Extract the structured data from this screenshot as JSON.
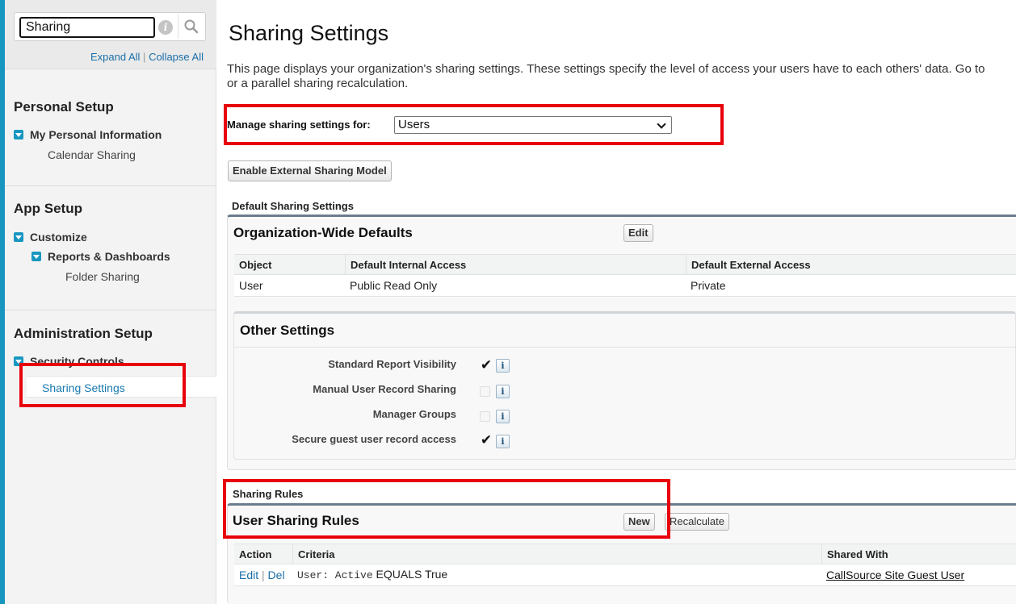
{
  "sidebar": {
    "search": {
      "value": "Sharing"
    },
    "expand_all": "Expand All",
    "separator": "|",
    "collapse_all": "Collapse All",
    "sections": [
      {
        "title": "Personal Setup",
        "node": "My Personal Information",
        "leaf": "Calendar Sharing"
      },
      {
        "title": "App Setup",
        "node": "Customize",
        "subnode": "Reports & Dashboards",
        "leaf": "Folder Sharing"
      },
      {
        "title": "Administration Setup",
        "node": "Security Controls",
        "leaf": "Sharing Settings"
      }
    ]
  },
  "main": {
    "title": "Sharing Settings",
    "description_line1": "This page displays your organization's sharing settings. These settings specify the level of access your users have to each others' data. Go to",
    "description_line2": "or a parallel sharing recalculation.",
    "manage_label": "Manage sharing settings for:",
    "manage_value": "Users",
    "enable_external_button": "Enable External Sharing Model",
    "default_section_label": "Default Sharing Settings",
    "owd": {
      "title": "Organization-Wide Defaults",
      "edit_button": "Edit",
      "columns": [
        "Object",
        "Default Internal Access",
        "Default External Access"
      ],
      "row": [
        "User",
        "Public Read Only",
        "Private"
      ]
    },
    "other_settings": {
      "title": "Other Settings",
      "items": [
        {
          "label": "Standard Report Visibility",
          "checked": true
        },
        {
          "label": "Manual User Record Sharing",
          "checked": false
        },
        {
          "label": "Manager Groups",
          "checked": false
        },
        {
          "label": "Secure guest user record access",
          "checked": true
        }
      ],
      "check_glyph": "✔",
      "info_glyph": "i"
    },
    "sharing_rules_label": "Sharing Rules",
    "user_rules": {
      "title": "User Sharing Rules",
      "new_button": "New",
      "recalculate_button": "Recalculate",
      "columns": [
        "Action",
        "Criteria",
        "Shared With"
      ],
      "row": {
        "edit": "Edit",
        "sep": "|",
        "del": "Del",
        "criteria_field": "User: Active",
        "criteria_op": "EQUALS True",
        "shared_with": "CallSource Site Guest User"
      }
    }
  }
}
